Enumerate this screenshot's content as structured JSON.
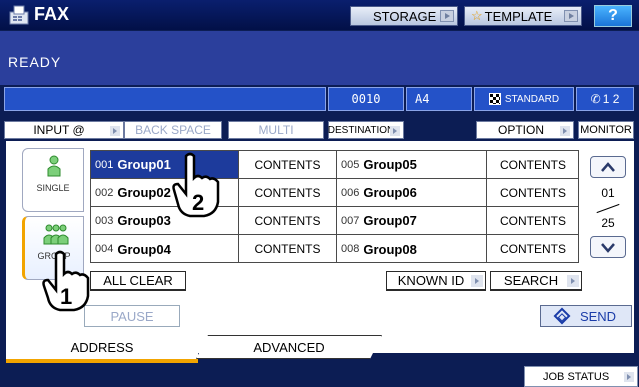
{
  "app": {
    "title": "FAX"
  },
  "top_buttons": {
    "storage": "STORAGE",
    "template": "TEMPLATE",
    "help": "?"
  },
  "status": {
    "text": "READY"
  },
  "dest_row": {
    "count": "0010",
    "paper_size": "A4",
    "resolution": "STANDARD",
    "lines": "1  2"
  },
  "toolbar": {
    "input": "INPUT @",
    "back_space": "BACK SPACE",
    "multi": "MULTI",
    "destination": "DESTINATION",
    "option": "OPTION",
    "monitor": "MONITOR"
  },
  "side_tabs": {
    "single": "SINGLE",
    "group": "GROUP"
  },
  "groups": [
    {
      "num": "001",
      "name": "Group01",
      "contents": "CONTENTS"
    },
    {
      "num": "002",
      "name": "Group02",
      "contents": "CONTENTS"
    },
    {
      "num": "003",
      "name": "Group03",
      "contents": "CONTENTS"
    },
    {
      "num": "004",
      "name": "Group04",
      "contents": "CONTENTS"
    },
    {
      "num": "005",
      "name": "Group05",
      "contents": "CONTENTS"
    },
    {
      "num": "006",
      "name": "Group06",
      "contents": "CONTENTS"
    },
    {
      "num": "007",
      "name": "Group07",
      "contents": "CONTENTS"
    },
    {
      "num": "008",
      "name": "Group08",
      "contents": "CONTENTS"
    }
  ],
  "pager": {
    "current": "01",
    "total": "25"
  },
  "actions": {
    "all_clear": "ALL CLEAR",
    "known_id": "KNOWN ID",
    "search": "SEARCH",
    "pause": "PAUSE",
    "send": "SEND"
  },
  "bottom_tabs": {
    "address": "ADDRESS",
    "advanced": "ADVANCED"
  },
  "job_status": "JOB STATUS",
  "callouts": {
    "step1": "1",
    "step2": "2"
  },
  "colors": {
    "accent": "#f2a400",
    "selected": "#1d3b9c",
    "titlebar": "#021047",
    "status": "#2b3f9c"
  }
}
